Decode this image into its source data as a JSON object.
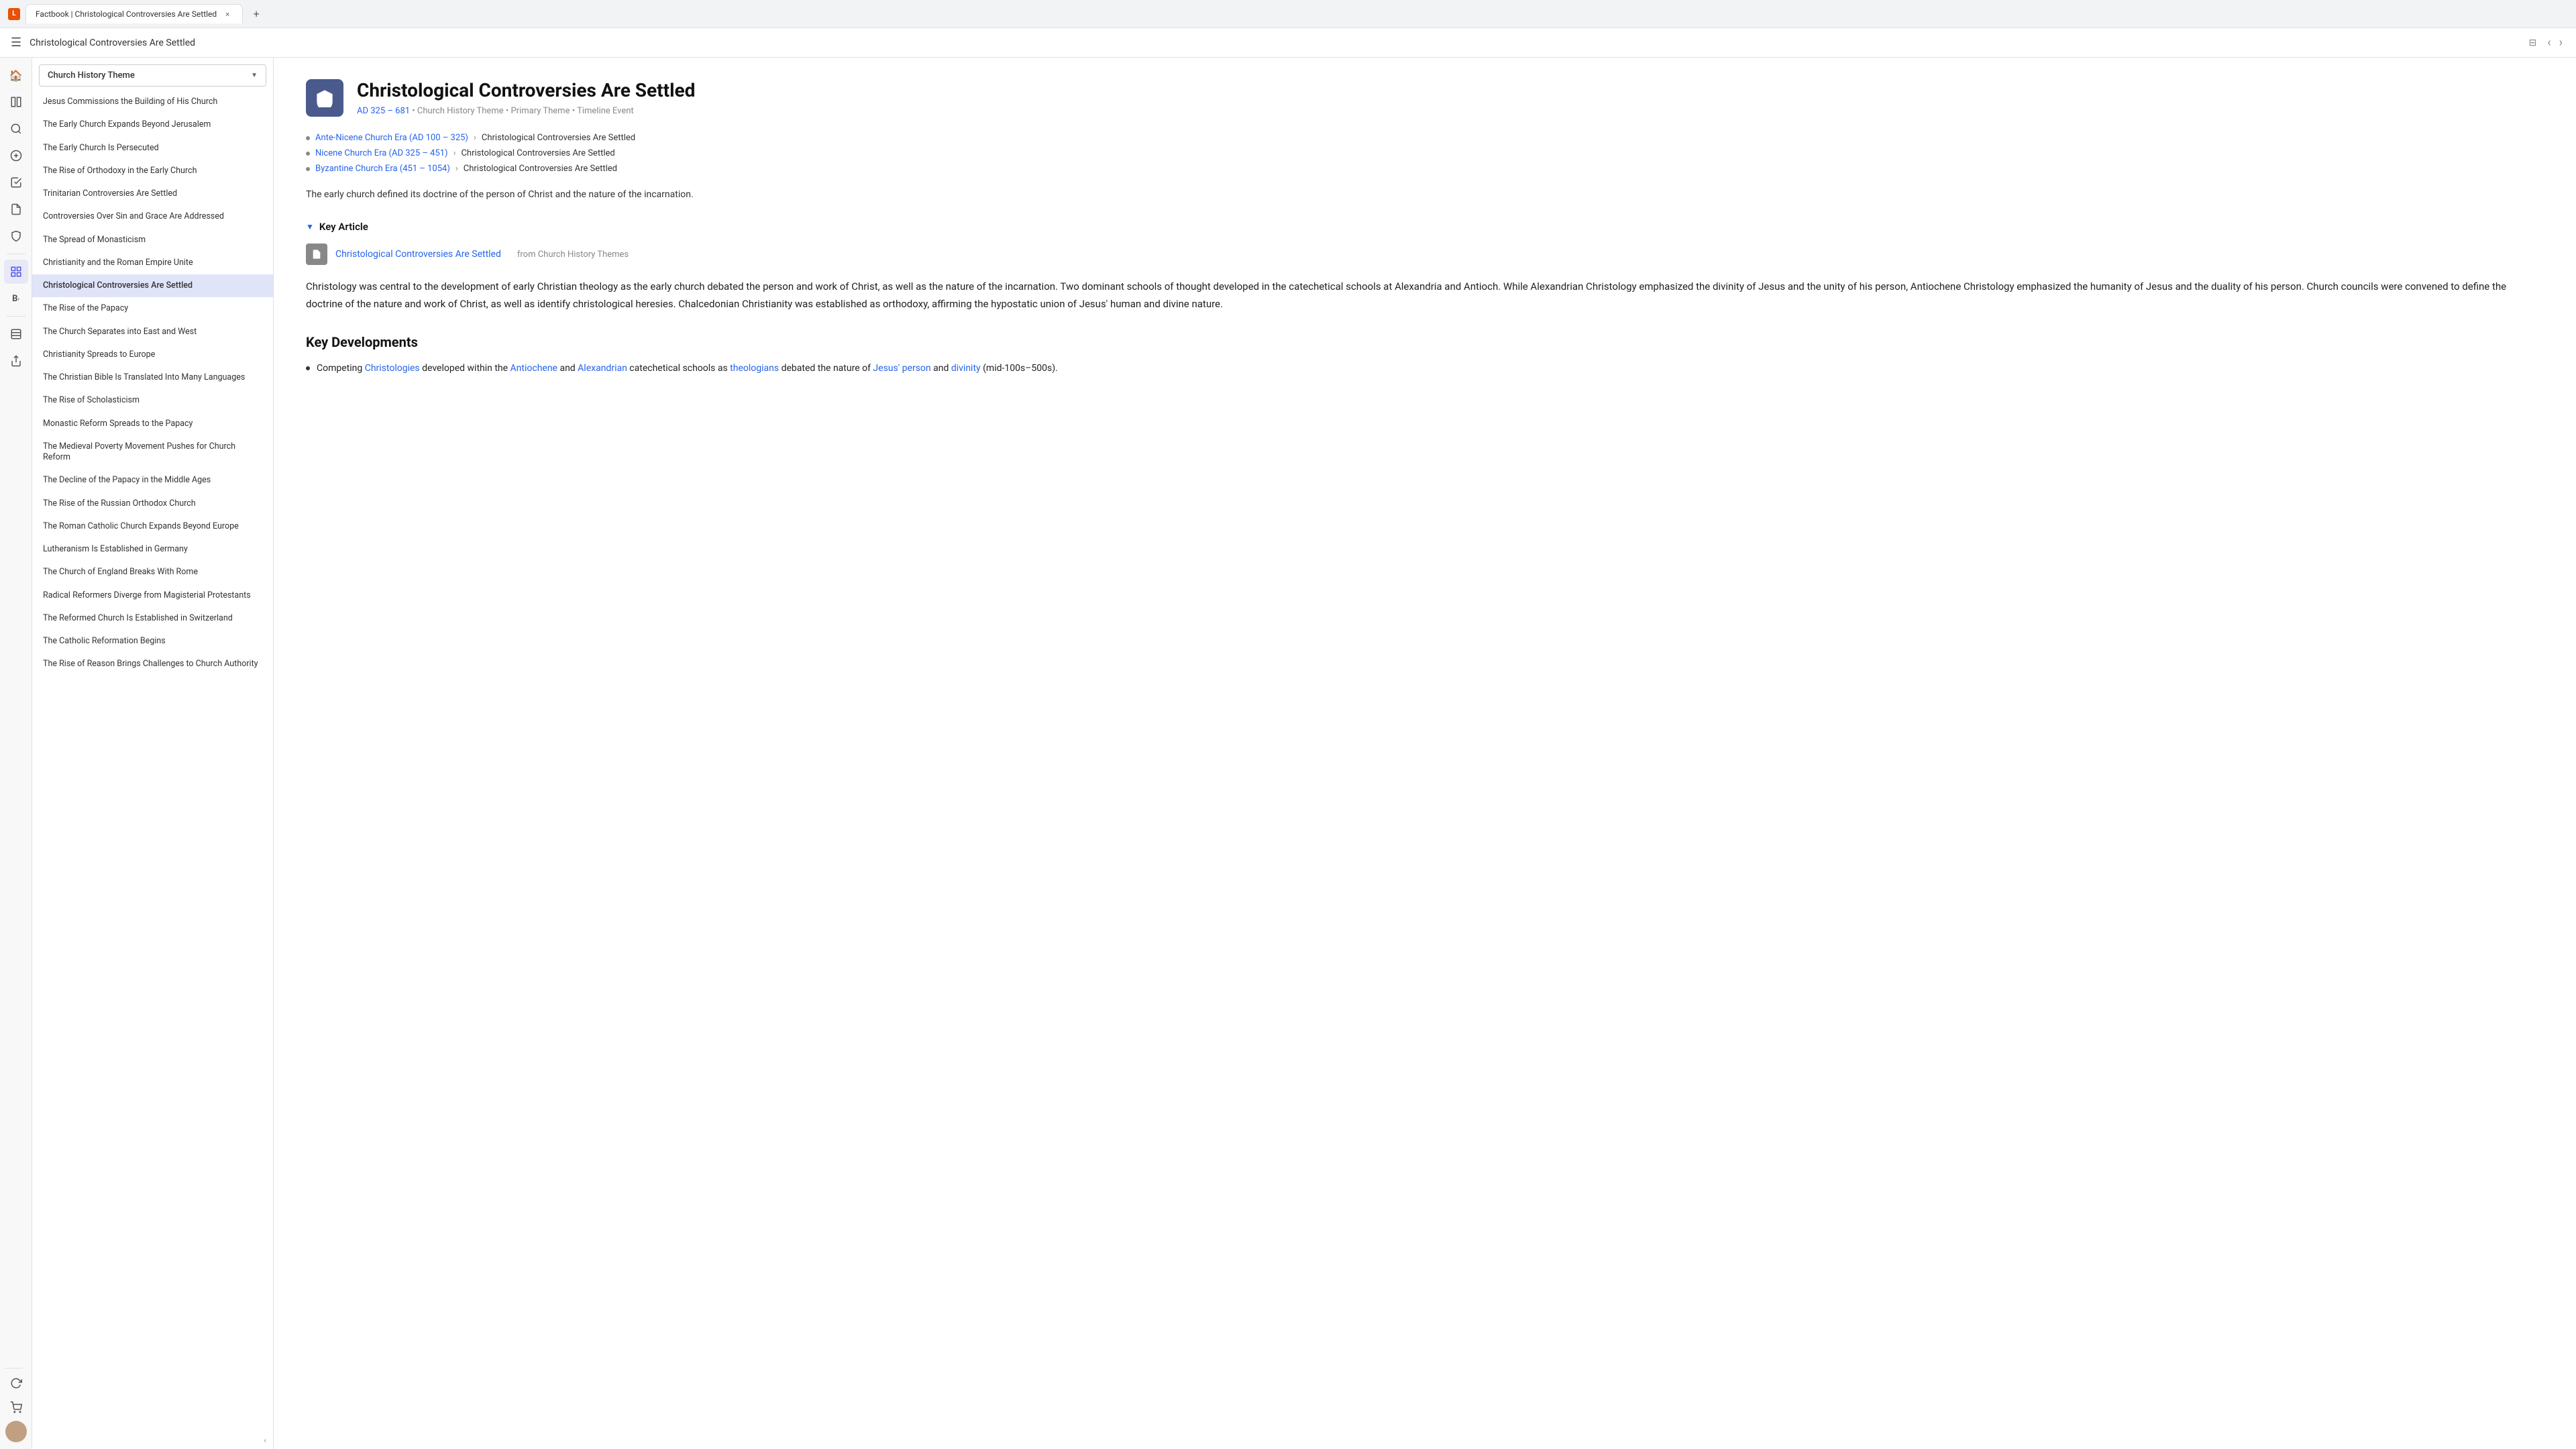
{
  "browser": {
    "tab_title": "Factbook | Christological Controversies Are Settled",
    "tab_close": "×",
    "tab_new": "+"
  },
  "app_bar": {
    "title": "Christological Controversies Are Settled",
    "icon_label": "⊟"
  },
  "sidebar": {
    "dropdown_label": "Church History Theme",
    "items": [
      {
        "id": "item-1",
        "label": "Jesus Commissions the Building of His Church",
        "active": false
      },
      {
        "id": "item-2",
        "label": "The Early Church Expands Beyond Jerusalem",
        "active": false
      },
      {
        "id": "item-3",
        "label": "The Early Church Is Persecuted",
        "active": false
      },
      {
        "id": "item-4",
        "label": "The Rise of Orthodoxy in the Early Church",
        "active": false
      },
      {
        "id": "item-5",
        "label": "Trinitarian Controversies Are Settled",
        "active": false
      },
      {
        "id": "item-6",
        "label": "Controversies Over Sin and Grace Are Addressed",
        "active": false
      },
      {
        "id": "item-7",
        "label": "The Spread of Monasticism",
        "active": false
      },
      {
        "id": "item-8",
        "label": "Christianity and the Roman Empire Unite",
        "active": false
      },
      {
        "id": "item-9",
        "label": "Christological Controversies Are Settled",
        "active": true
      },
      {
        "id": "item-10",
        "label": "The Rise of the Papacy",
        "active": false
      },
      {
        "id": "item-11",
        "label": "The Church Separates into East and West",
        "active": false
      },
      {
        "id": "item-12",
        "label": "Christianity Spreads to Europe",
        "active": false
      },
      {
        "id": "item-13",
        "label": "The Christian Bible Is Translated Into Many Languages",
        "active": false
      },
      {
        "id": "item-14",
        "label": "The Rise of Scholasticism",
        "active": false
      },
      {
        "id": "item-15",
        "label": "Monastic Reform Spreads to the Papacy",
        "active": false
      },
      {
        "id": "item-16",
        "label": "The Medieval Poverty Movement Pushes for Church Reform",
        "active": false
      },
      {
        "id": "item-17",
        "label": "The Decline of the Papacy in the Middle Ages",
        "active": false
      },
      {
        "id": "item-18",
        "label": "The Rise of the Russian Orthodox Church",
        "active": false
      },
      {
        "id": "item-19",
        "label": "The Roman Catholic Church Expands Beyond Europe",
        "active": false
      },
      {
        "id": "item-20",
        "label": "Lutheranism Is Established in Germany",
        "active": false
      },
      {
        "id": "item-21",
        "label": "The Church of England Breaks With Rome",
        "active": false
      },
      {
        "id": "item-22",
        "label": "Radical Reformers Diverge from Magisterial Protestants",
        "active": false
      },
      {
        "id": "item-23",
        "label": "The Reformed Church Is Established in Switzerland",
        "active": false
      },
      {
        "id": "item-24",
        "label": "The Catholic Reformation Begins",
        "active": false
      },
      {
        "id": "item-25",
        "label": "The Rise of Reason Brings Challenges to Church Authority",
        "active": false
      }
    ]
  },
  "content": {
    "page_title": "Christological Controversies Are Settled",
    "date_range": "AD 325 – 681",
    "meta_theme": "Church History Theme",
    "meta_type": "Primary Theme",
    "meta_event": "Timeline Event",
    "breadcrumbs": [
      {
        "link_text": "Ante-Nicene Church Era (AD 100 – 325)",
        "separator": "›",
        "current": "Christological Controversies Are Settled"
      },
      {
        "link_text": "Nicene Church Era (AD 325 – 451)",
        "separator": "›",
        "current": "Christological Controversies Are Settled"
      },
      {
        "link_text": "Byzantine Church Era (451 – 1054)",
        "separator": "›",
        "current": "Christological Controversies Are Settled"
      }
    ],
    "description": "The early church defined its doctrine of the person of Christ and the nature of the incarnation.",
    "key_article_header": "Key Article",
    "key_article_title": "Christological Controversies Are Settled",
    "key_article_source": "from Church History Themes",
    "body_text": "Christology was central to the development of early Christian theology as the early church debated the person and work of Christ, as well as the nature of the incarnation. Two dominant schools of thought developed in the catechetical schools at Alexandria and Antioch. While Alexandrian Christology emphasized the divinity of Jesus and the unity of his person, Antiochene Christology emphasized the humanity of Jesus and the duality of his person. Church councils were convened to define the doctrine of the nature and work of Christ, as well as identify christological heresies. Chalcedonian Christianity was established as orthodoxy, affirming the hypostatic union of Jesus' human and divine nature.",
    "key_developments_header": "Key Developments",
    "key_developments": [
      {
        "text_parts": [
          {
            "text": "Competing ",
            "type": "plain"
          },
          {
            "text": "Christologies",
            "type": "link"
          },
          {
            "text": " developed within the ",
            "type": "plain"
          },
          {
            "text": "Antiochene",
            "type": "link"
          },
          {
            "text": " and ",
            "type": "plain"
          },
          {
            "text": "Alexandrian",
            "type": "link"
          },
          {
            "text": " catechetical schools as ",
            "type": "plain"
          },
          {
            "text": "theologians",
            "type": "link"
          },
          {
            "text": " debated the nature of ",
            "type": "plain"
          },
          {
            "text": "Jesus' person",
            "type": "link"
          },
          {
            "text": " and ",
            "type": "plain"
          },
          {
            "text": "divinity",
            "type": "link"
          },
          {
            "text": " (mid-100s–500s).",
            "type": "plain"
          }
        ]
      }
    ]
  },
  "rail_icons": {
    "home": "🏠",
    "library": "📚",
    "search": "🔍",
    "bookmark": "＋",
    "check": "☑",
    "doc": "📄",
    "shield": "🛡",
    "grid": "⊞",
    "expand": "B",
    "layers": "⊟",
    "share": "↗",
    "refresh": "↺",
    "cart": "🛒"
  }
}
